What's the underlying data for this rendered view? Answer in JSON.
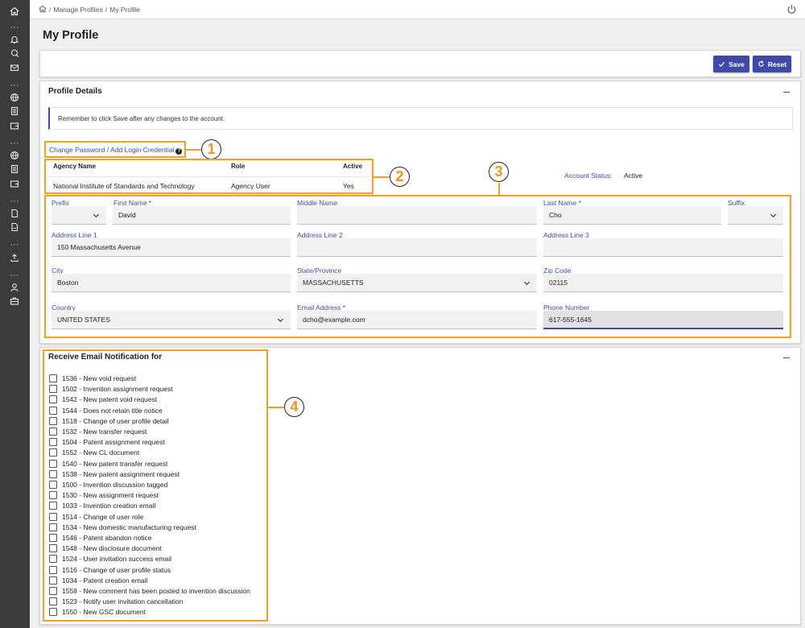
{
  "breadcrumb": [
    "Manage Profiles",
    "My Profile"
  ],
  "page_title": "My Profile",
  "toolbar": {
    "save_label": "Save",
    "reset_label": "Reset"
  },
  "profile_details": {
    "title": "Profile Details",
    "notice": "Remember to click Save after any changes to the account.",
    "change_password_link": "Change Password / Add Login Credential",
    "agency_table": {
      "headers": [
        "Agency Name",
        "Role",
        "Active"
      ],
      "row": [
        "National Institute of Standards and Technology",
        "Agency User",
        "Yes"
      ]
    },
    "account_status_label": "Account Status:",
    "account_status_value": "Active"
  },
  "form": {
    "prefix": {
      "label": "Prefix",
      "value": ""
    },
    "first_name": {
      "label": "First Name *",
      "value": "David"
    },
    "middle_name": {
      "label": "Middle Name",
      "value": ""
    },
    "last_name": {
      "label": "Last Name *",
      "value": "Cho"
    },
    "suffix": {
      "label": "Suffix",
      "value": ""
    },
    "address1": {
      "label": "Address Line 1",
      "value": "150 Massachusetts Avenue"
    },
    "address2": {
      "label": "Address Line 2",
      "value": ""
    },
    "address3": {
      "label": "Address Line 3",
      "value": ""
    },
    "city": {
      "label": "City",
      "value": "Boston"
    },
    "state": {
      "label": "State/Province",
      "value": "MASSACHUSETTS"
    },
    "zip": {
      "label": "Zip Code",
      "value": "02115"
    },
    "country": {
      "label": "Country",
      "value": "UNITED STATES"
    },
    "email": {
      "label": "Email Address *",
      "value": "dcho@example.com"
    },
    "phone": {
      "label": "Phone Number",
      "value": "617-555-1645"
    }
  },
  "notifications": {
    "title": "Receive Email Notification for",
    "items": [
      "1536 - New void request",
      "1502 - Invention assignment request",
      "1542 - New patent void request",
      "1544 - Does not retain title notice",
      "1518 - Change of user profile detail",
      "1532 - New transfer request",
      "1504 - Patent assignment request",
      "1552 - New CL document",
      "1540 - New patent transfer request",
      "1538 - New patent assignment request",
      "1500 - Invention discussion tagged",
      "1530 - New assignment request",
      "1033 - Invention creation email",
      "1514 - Change of user role",
      "1534 - New domestic manufacturing request",
      "1546 - Patent abandon notice",
      "1548 - New disclosure document",
      "1524 - User invitation success email",
      "1516 - Change of user profile status",
      "1034 - Patent creation email",
      "1558 - New comment has been posted to invention discussion",
      "1523 - Notify user invitation cancellation",
      "1550 - New GSC document"
    ]
  },
  "callouts": [
    "1",
    "2",
    "3",
    "4"
  ],
  "icons": {
    "rail": [
      "home-icon",
      "bell-icon",
      "search-bell-icon",
      "mail-icon",
      "globe-icon",
      "document-list-icon",
      "wallet-icon",
      "globe-icon",
      "document-list-icon",
      "wallet-icon",
      "file-icon",
      "pdf-file-icon",
      "upload-icon",
      "user-icon",
      "briefcase-icon"
    ],
    "breadcrumb_home": "home-icon",
    "power": "power-icon"
  },
  "colors": {
    "accent": "#3f4aa8",
    "highlight": "#f5a023",
    "rail": "#3b3b3b"
  }
}
